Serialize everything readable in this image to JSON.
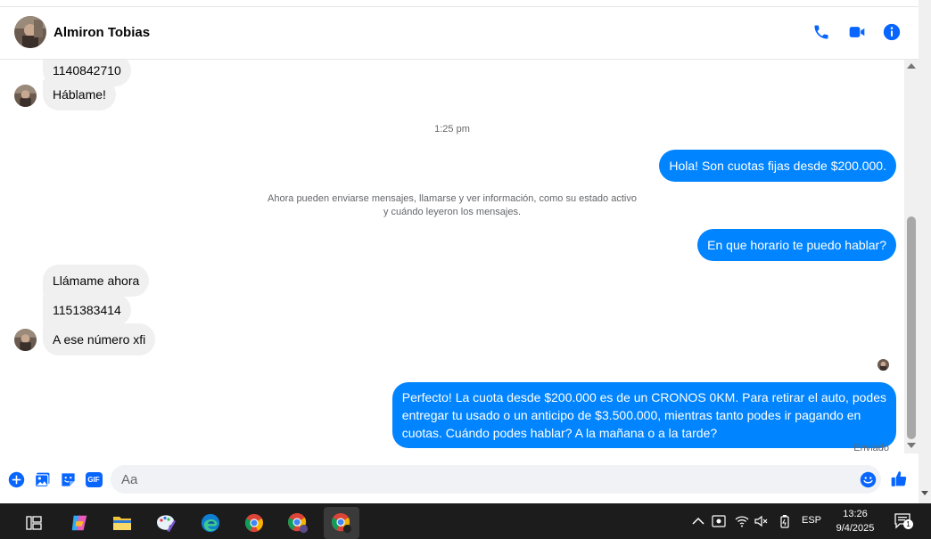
{
  "header": {
    "contact_name": "Almiron Tobias",
    "icons": [
      "phone-icon",
      "video-camera-icon",
      "info-icon"
    ]
  },
  "messages": {
    "partial_number": "1140842710",
    "hablame": "Háblame!",
    "time_divider": "1:25 pm",
    "out_1": "Hola! Son cuotas fijas desde $200.000.",
    "system_line1": "Ahora pueden enviarse mensajes, llamarse y ver información, como su estado activo",
    "system_line2": "y cuándo leyeron los mensajes.",
    "out_2": "En que horario te puedo hablar?",
    "in_llamame": "Llámame ahora",
    "in_number": "1151383414",
    "in_numero": "A ese número xfi",
    "out_3_line1": "Perfecto! La cuota desde $200.000 es de un CRONOS 0KM. Para retirar el auto, podes",
    "out_3_line2": "entregar tu usado o un anticipo de $3.500.000, mientras tanto podes ir pagando en",
    "out_3_line3": "cuotas. Cuándo podes hablar? A la mañana o a la tarde?",
    "status": "Enviado"
  },
  "composer": {
    "placeholder": "Aa",
    "icons": [
      "plus-icon",
      "photo-icon",
      "sticker-icon",
      "gif-icon",
      "emoji-icon",
      "like-icon"
    ],
    "gif_label": "GIF"
  },
  "taskbar": {
    "apps": [
      "task-view-icon",
      "copilot-icon",
      "file-explorer-icon",
      "paint-icon",
      "edge-icon",
      "chrome-icon",
      "chrome-profile-icon",
      "chrome-profile-active-icon"
    ],
    "language": "ESP",
    "time": "13:26",
    "date": "9/4/2025",
    "notification_count": "1"
  },
  "colors": {
    "outgoing": "#0084ff",
    "incoming": "#f0f0f0",
    "accent": "#0866ff",
    "taskbar": "#1c1c1c"
  }
}
